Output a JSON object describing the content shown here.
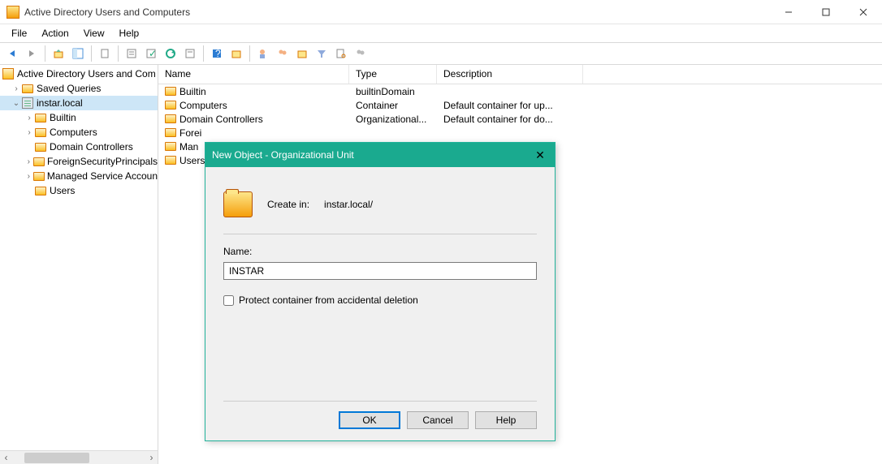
{
  "window": {
    "title": "Active Directory Users and Computers"
  },
  "menu": {
    "items": [
      "File",
      "Action",
      "View",
      "Help"
    ]
  },
  "tree": {
    "root": "Active Directory Users and Com",
    "nodes": [
      {
        "label": "Saved Queries",
        "depth": 1,
        "expander": "›",
        "icon": "folder"
      },
      {
        "label": "instar.local",
        "depth": 1,
        "expander": "⌄",
        "icon": "domain",
        "selected": true
      },
      {
        "label": "Builtin",
        "depth": 2,
        "expander": "›",
        "icon": "folder"
      },
      {
        "label": "Computers",
        "depth": 2,
        "expander": "›",
        "icon": "folder"
      },
      {
        "label": "Domain Controllers",
        "depth": 2,
        "expander": "",
        "icon": "folder"
      },
      {
        "label": "ForeignSecurityPrincipals",
        "depth": 2,
        "expander": "›",
        "icon": "folder"
      },
      {
        "label": "Managed Service Accoun",
        "depth": 2,
        "expander": "›",
        "icon": "folder"
      },
      {
        "label": "Users",
        "depth": 2,
        "expander": "",
        "icon": "folder"
      }
    ]
  },
  "list": {
    "columns": {
      "name": "Name",
      "type": "Type",
      "desc": "Description"
    },
    "rows": [
      {
        "name": "Builtin",
        "type": "builtinDomain",
        "desc": ""
      },
      {
        "name": "Computers",
        "type": "Container",
        "desc": "Default container for up..."
      },
      {
        "name": "Domain Controllers",
        "type": "Organizational...",
        "desc": "Default container for do..."
      },
      {
        "name": "Forei",
        "type": "",
        "desc": ""
      },
      {
        "name": "Man",
        "type": "",
        "desc": ""
      },
      {
        "name": "Users",
        "type": "",
        "desc": ""
      }
    ]
  },
  "dialog": {
    "title": "New Object - Organizational Unit",
    "create_in_label": "Create in:",
    "create_in_path": "instar.local/",
    "name_label": "Name:",
    "name_value": "INSTAR",
    "protect_label": "Protect container from accidental deletion",
    "buttons": {
      "ok": "OK",
      "cancel": "Cancel",
      "help": "Help"
    }
  }
}
